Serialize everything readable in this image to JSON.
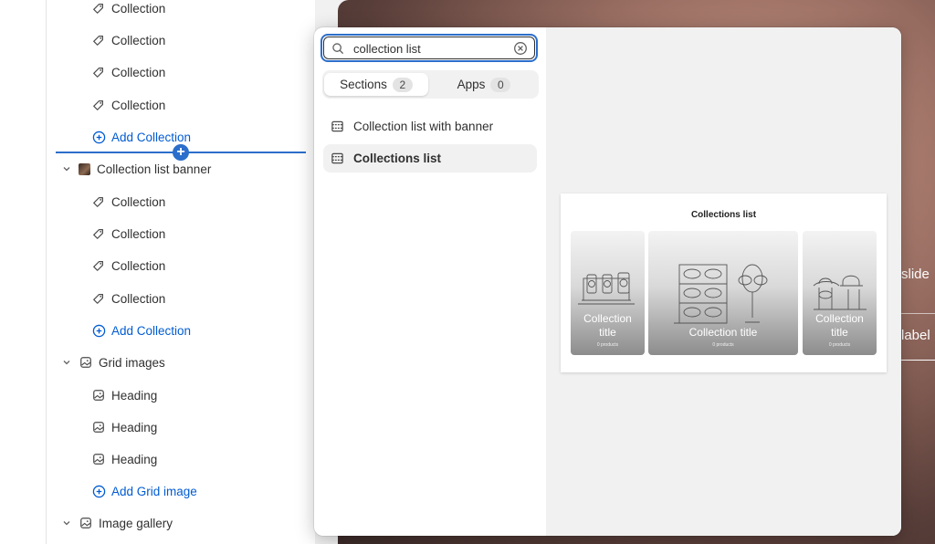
{
  "tree": {
    "items": [
      {
        "label": "Collection",
        "kind": "child",
        "icon": "tag-icon"
      },
      {
        "label": "Collection",
        "kind": "child",
        "icon": "tag-icon"
      },
      {
        "label": "Collection",
        "kind": "child",
        "icon": "tag-icon"
      },
      {
        "label": "Collection",
        "kind": "child",
        "icon": "tag-icon"
      },
      {
        "label": "Add Collection",
        "kind": "add",
        "icon": "plus-circle-icon"
      },
      {
        "label": "Collection list banner",
        "kind": "parent",
        "icon": "image-thumbnail"
      },
      {
        "label": "Collection",
        "kind": "child",
        "icon": "tag-icon"
      },
      {
        "label": "Collection",
        "kind": "child",
        "icon": "tag-icon"
      },
      {
        "label": "Collection",
        "kind": "child",
        "icon": "tag-icon"
      },
      {
        "label": "Collection",
        "kind": "child",
        "icon": "tag-icon"
      },
      {
        "label": "Add Collection",
        "kind": "add",
        "icon": "plus-circle-icon"
      },
      {
        "label": "Grid images",
        "kind": "parent",
        "icon": "image-icon"
      },
      {
        "label": "Heading",
        "kind": "child",
        "icon": "image-icon"
      },
      {
        "label": "Heading",
        "kind": "child",
        "icon": "image-icon"
      },
      {
        "label": "Heading",
        "kind": "child",
        "icon": "image-icon"
      },
      {
        "label": "Add Grid image",
        "kind": "add",
        "icon": "plus-circle-icon"
      },
      {
        "label": "Image gallery",
        "kind": "parent",
        "icon": "image-icon"
      }
    ]
  },
  "hero": {
    "text1": "slide",
    "text2": "label"
  },
  "popup": {
    "search": {
      "value": "collection list",
      "placeholder": ""
    },
    "tabs": [
      {
        "label": "Sections",
        "count": "2",
        "active": true
      },
      {
        "label": "Apps",
        "count": "0",
        "active": false
      }
    ],
    "results": [
      {
        "label": "Collection list with banner",
        "selected": false
      },
      {
        "label": "Collections list",
        "selected": true
      }
    ],
    "preview": {
      "title": "Collections list",
      "tiles": [
        {
          "title": "Collection\ntitle",
          "sub": "0 products"
        },
        {
          "title": "Collection title",
          "sub": "0 products"
        },
        {
          "title": "Collection\ntitle",
          "sub": "0 products"
        }
      ]
    }
  },
  "colors": {
    "accent": "#005bd3",
    "focus": "#2c6ecb",
    "text": "#303030"
  }
}
